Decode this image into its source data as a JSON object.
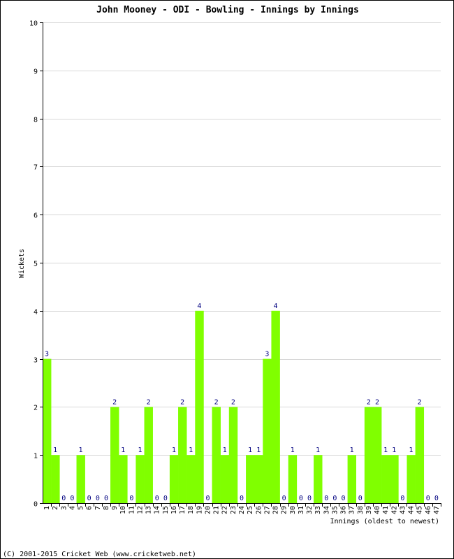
{
  "chart_data": {
    "type": "bar",
    "title": "John Mooney - ODI - Bowling - Innings by Innings",
    "xlabel": "Innings (oldest to newest)",
    "ylabel": "Wickets",
    "ylim": [
      0,
      10
    ],
    "yticks": [
      "0",
      "1",
      "2",
      "3",
      "4",
      "5",
      "6",
      "7",
      "8",
      "9",
      "10"
    ],
    "grid": true,
    "legend": "none",
    "bar_color": "#80ff00",
    "label_color": "#000080",
    "categories": [
      "1",
      "2",
      "3",
      "4",
      "5",
      "6",
      "7",
      "8",
      "9",
      "10",
      "11",
      "12",
      "13",
      "14",
      "15",
      "16",
      "17",
      "18",
      "19",
      "20",
      "21",
      "22",
      "23",
      "24",
      "25",
      "26",
      "27",
      "28",
      "29",
      "30",
      "31",
      "32",
      "33",
      "34",
      "35",
      "36",
      "37",
      "38",
      "39",
      "40",
      "41",
      "42",
      "43",
      "44",
      "45",
      "46",
      "47"
    ],
    "values": [
      3,
      1,
      0,
      0,
      1,
      0,
      0,
      0,
      2,
      1,
      0,
      1,
      2,
      0,
      0,
      1,
      2,
      1,
      4,
      0,
      2,
      1,
      2,
      0,
      1,
      1,
      3,
      4,
      0,
      1,
      0,
      0,
      1,
      0,
      0,
      0,
      1,
      0,
      2,
      2,
      1,
      1,
      0,
      1,
      2,
      0,
      0
    ]
  },
  "footer": "(C) 2001-2015 Cricket Web (www.cricketweb.net)"
}
